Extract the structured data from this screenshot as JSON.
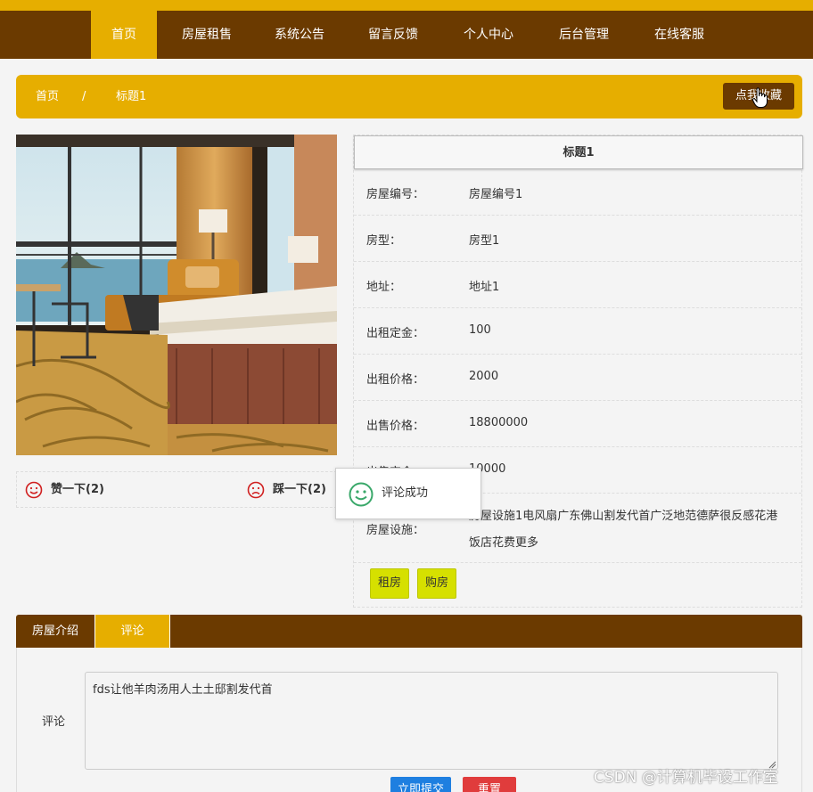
{
  "nav": {
    "items": [
      {
        "label": "首页",
        "active": true
      },
      {
        "label": "房屋租售"
      },
      {
        "label": "系统公告"
      },
      {
        "label": "留言反馈"
      },
      {
        "label": "个人中心"
      },
      {
        "label": "后台管理"
      },
      {
        "label": "在线客服"
      }
    ]
  },
  "breadcrumb": {
    "home": "首页",
    "sep": "/",
    "current": "标题1",
    "fav_button": "点我收藏"
  },
  "likes": {
    "up": "赞一下(2)",
    "down": "踩一下(2)"
  },
  "detail": {
    "title": "标题1",
    "rows": [
      {
        "key": "房屋编号：",
        "value": "房屋编号1"
      },
      {
        "key": "房型：",
        "value": "房型1"
      },
      {
        "key": "地址：",
        "value": "地址1"
      },
      {
        "key": "出租定金：",
        "value": "100"
      },
      {
        "key": "出租价格：",
        "value": "2000"
      },
      {
        "key": "出售价格：",
        "value": "18800000"
      },
      {
        "key": "出售定金：",
        "value": "10000"
      },
      {
        "key": "房屋设施：",
        "value_line1": "房屋设施1电风扇广东佛山割发代首广泛地范德萨很反感花港",
        "value_line2": "饭店花费更多"
      }
    ],
    "rent_button": "租房",
    "buy_button": "购房"
  },
  "toast": {
    "message": "评论成功"
  },
  "tabs": [
    {
      "label": "房屋介绍"
    },
    {
      "label": "评论",
      "active": true
    }
  ],
  "comment": {
    "label": "评论",
    "value": "fds让他羊肉汤用人土土邸割发代首",
    "submit": "立即提交",
    "reset": "重置"
  },
  "watermark": "CSDN @计算机毕设工作室",
  "colors": {
    "nav_bg": "#6b3a00",
    "accent": "#e6ae00",
    "action_btn": "#d6e000",
    "submit": "#1e7fe0",
    "reset": "#e03c3c"
  }
}
